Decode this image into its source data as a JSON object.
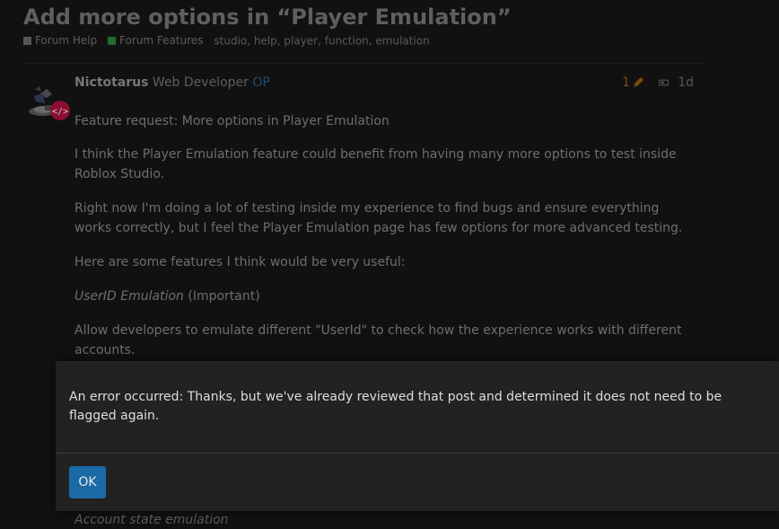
{
  "topic": {
    "title": "Add more options in “Player Emulation”",
    "categories": [
      {
        "label": "Forum Help",
        "color": "#555555"
      },
      {
        "label": "Forum Features",
        "color": "#1e6b34"
      }
    ],
    "tags": "studio, help, player, function, emulation"
  },
  "post": {
    "username": "Nictotarus",
    "user_title": "Web Developer",
    "op_badge": "OP",
    "edit_count": "1",
    "age": "1d",
    "paragraphs": {
      "p0": "Feature request: More options in Player Emulation",
      "p1": "I think the Player Emulation feature could benefit from having many more options to test inside Roblox Studio.",
      "p2": "Right now I'm doing a lot of testing inside my experience to find bugs and ensure everything works correctly, but I feel the Player Emulation page has few options for more advanced testing.",
      "p3": "Here are some features I think would be very useful:",
      "p4_em": "UserID Emulation",
      "p4_rest": " (Important)",
      "p5": "Allow developers to emulate different \"UserId\" to check how the experience works with different accounts."
    },
    "trailing_heading": "Account state emulation"
  },
  "dialog": {
    "message": "An error occurred: Thanks, but we've already reviewed that post and determined it does not need to be flagged again.",
    "ok_label": "OK"
  },
  "colors": {
    "background": "#111111",
    "dialog_bg": "#222222",
    "ok_button": "#1b6aa6",
    "forum_help": "#555555",
    "forum_features": "#1e6b34",
    "edit_orange": "#7a4a12"
  },
  "icons": [
    "pencil-icon",
    "reply-thread-icon",
    "developer-badge-icon"
  ]
}
